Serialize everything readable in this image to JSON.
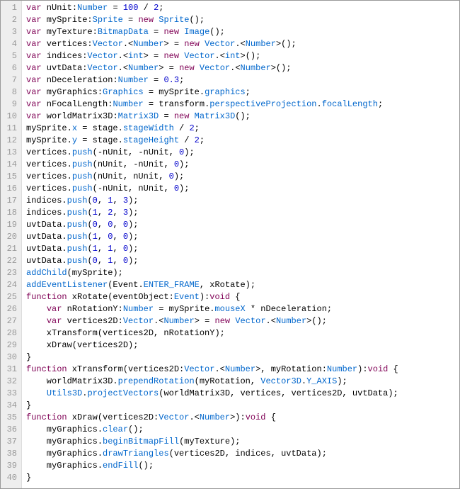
{
  "lineCount": 40,
  "lines": [
    [
      [
        "kw",
        "var"
      ],
      [
        "ident",
        " nUnit"
      ],
      [
        "op",
        ":"
      ],
      [
        "type",
        "Number"
      ],
      [
        "ident",
        " = "
      ],
      [
        "num",
        "100"
      ],
      [
        "ident",
        " / "
      ],
      [
        "num",
        "2"
      ],
      [
        "ident",
        ";"
      ]
    ],
    [
      [
        "kw",
        "var"
      ],
      [
        "ident",
        " mySprite"
      ],
      [
        "op",
        ":"
      ],
      [
        "type",
        "Sprite"
      ],
      [
        "ident",
        " = "
      ],
      [
        "kw",
        "new"
      ],
      [
        "ident",
        " "
      ],
      [
        "type",
        "Sprite"
      ],
      [
        "ident",
        "();"
      ]
    ],
    [
      [
        "kw",
        "var"
      ],
      [
        "ident",
        " myTexture"
      ],
      [
        "op",
        ":"
      ],
      [
        "type",
        "BitmapData"
      ],
      [
        "ident",
        " = "
      ],
      [
        "kw",
        "new"
      ],
      [
        "ident",
        " "
      ],
      [
        "type",
        "Image"
      ],
      [
        "ident",
        "();"
      ]
    ],
    [
      [
        "kw",
        "var"
      ],
      [
        "ident",
        " vertices"
      ],
      [
        "op",
        ":"
      ],
      [
        "type",
        "Vector"
      ],
      [
        "dot",
        "."
      ],
      [
        "ident",
        "<"
      ],
      [
        "type",
        "Number"
      ],
      [
        "ident",
        "> = "
      ],
      [
        "kw",
        "new"
      ],
      [
        "ident",
        " "
      ],
      [
        "type",
        "Vector"
      ],
      [
        "dot",
        "."
      ],
      [
        "ident",
        "<"
      ],
      [
        "type",
        "Number"
      ],
      [
        "ident",
        ">();"
      ]
    ],
    [
      [
        "kw",
        "var"
      ],
      [
        "ident",
        " indices"
      ],
      [
        "op",
        ":"
      ],
      [
        "type",
        "Vector"
      ],
      [
        "dot",
        "."
      ],
      [
        "ident",
        "<"
      ],
      [
        "type",
        "int"
      ],
      [
        "ident",
        "> = "
      ],
      [
        "kw",
        "new"
      ],
      [
        "ident",
        " "
      ],
      [
        "type",
        "Vector"
      ],
      [
        "dot",
        "."
      ],
      [
        "ident",
        "<"
      ],
      [
        "type",
        "int"
      ],
      [
        "ident",
        ">();"
      ]
    ],
    [
      [
        "kw",
        "var"
      ],
      [
        "ident",
        " uvtData"
      ],
      [
        "op",
        ":"
      ],
      [
        "type",
        "Vector"
      ],
      [
        "dot",
        "."
      ],
      [
        "ident",
        "<"
      ],
      [
        "type",
        "Number"
      ],
      [
        "ident",
        "> = "
      ],
      [
        "kw",
        "new"
      ],
      [
        "ident",
        " "
      ],
      [
        "type",
        "Vector"
      ],
      [
        "dot",
        "."
      ],
      [
        "ident",
        "<"
      ],
      [
        "type",
        "Number"
      ],
      [
        "ident",
        ">();"
      ]
    ],
    [
      [
        "kw",
        "var"
      ],
      [
        "ident",
        " nDeceleration"
      ],
      [
        "op",
        ":"
      ],
      [
        "type",
        "Number"
      ],
      [
        "ident",
        " = "
      ],
      [
        "num",
        "0.3"
      ],
      [
        "ident",
        ";"
      ]
    ],
    [
      [
        "kw",
        "var"
      ],
      [
        "ident",
        " myGraphics"
      ],
      [
        "op",
        ":"
      ],
      [
        "type",
        "Graphics"
      ],
      [
        "ident",
        " = mySprite"
      ],
      [
        "dot",
        "."
      ],
      [
        "prop",
        "graphics"
      ],
      [
        "ident",
        ";"
      ]
    ],
    [
      [
        "kw",
        "var"
      ],
      [
        "ident",
        " nFocalLength"
      ],
      [
        "op",
        ":"
      ],
      [
        "type",
        "Number"
      ],
      [
        "ident",
        " = transform"
      ],
      [
        "dot",
        "."
      ],
      [
        "prop",
        "perspectiveProjection"
      ],
      [
        "dot",
        "."
      ],
      [
        "prop",
        "focalLength"
      ],
      [
        "ident",
        ";"
      ]
    ],
    [
      [
        "kw",
        "var"
      ],
      [
        "ident",
        " worldMatrix3D"
      ],
      [
        "op",
        ":"
      ],
      [
        "type",
        "Matrix3D"
      ],
      [
        "ident",
        " = "
      ],
      [
        "kw",
        "new"
      ],
      [
        "ident",
        " "
      ],
      [
        "type",
        "Matrix3D"
      ],
      [
        "ident",
        "();"
      ]
    ],
    [
      [
        "ident",
        "mySprite"
      ],
      [
        "dot",
        "."
      ],
      [
        "prop",
        "x"
      ],
      [
        "ident",
        " = stage"
      ],
      [
        "dot",
        "."
      ],
      [
        "prop",
        "stageWidth"
      ],
      [
        "ident",
        " / "
      ],
      [
        "num",
        "2"
      ],
      [
        "ident",
        ";"
      ]
    ],
    [
      [
        "ident",
        "mySprite"
      ],
      [
        "dot",
        "."
      ],
      [
        "prop",
        "y"
      ],
      [
        "ident",
        " = stage"
      ],
      [
        "dot",
        "."
      ],
      [
        "prop",
        "stageHeight"
      ],
      [
        "ident",
        " / "
      ],
      [
        "num",
        "2"
      ],
      [
        "ident",
        ";"
      ]
    ],
    [
      [
        "ident",
        "vertices"
      ],
      [
        "dot",
        "."
      ],
      [
        "prop",
        "push"
      ],
      [
        "ident",
        "(-nUnit, -nUnit, "
      ],
      [
        "num",
        "0"
      ],
      [
        "ident",
        ");"
      ]
    ],
    [
      [
        "ident",
        "vertices"
      ],
      [
        "dot",
        "."
      ],
      [
        "prop",
        "push"
      ],
      [
        "ident",
        "(nUnit, -nUnit, "
      ],
      [
        "num",
        "0"
      ],
      [
        "ident",
        ");"
      ]
    ],
    [
      [
        "ident",
        "vertices"
      ],
      [
        "dot",
        "."
      ],
      [
        "prop",
        "push"
      ],
      [
        "ident",
        "(nUnit, nUnit, "
      ],
      [
        "num",
        "0"
      ],
      [
        "ident",
        ");"
      ]
    ],
    [
      [
        "ident",
        "vertices"
      ],
      [
        "dot",
        "."
      ],
      [
        "prop",
        "push"
      ],
      [
        "ident",
        "(-nUnit, nUnit, "
      ],
      [
        "num",
        "0"
      ],
      [
        "ident",
        ");"
      ]
    ],
    [
      [
        "ident",
        "indices"
      ],
      [
        "dot",
        "."
      ],
      [
        "prop",
        "push"
      ],
      [
        "ident",
        "("
      ],
      [
        "num",
        "0"
      ],
      [
        "ident",
        ", "
      ],
      [
        "num",
        "1"
      ],
      [
        "ident",
        ", "
      ],
      [
        "num",
        "3"
      ],
      [
        "ident",
        ");"
      ]
    ],
    [
      [
        "ident",
        "indices"
      ],
      [
        "dot",
        "."
      ],
      [
        "prop",
        "push"
      ],
      [
        "ident",
        "("
      ],
      [
        "num",
        "1"
      ],
      [
        "ident",
        ", "
      ],
      [
        "num",
        "2"
      ],
      [
        "ident",
        ", "
      ],
      [
        "num",
        "3"
      ],
      [
        "ident",
        ");"
      ]
    ],
    [
      [
        "ident",
        "uvtData"
      ],
      [
        "dot",
        "."
      ],
      [
        "prop",
        "push"
      ],
      [
        "ident",
        "("
      ],
      [
        "num",
        "0"
      ],
      [
        "ident",
        ", "
      ],
      [
        "num",
        "0"
      ],
      [
        "ident",
        ", "
      ],
      [
        "num",
        "0"
      ],
      [
        "ident",
        ");"
      ]
    ],
    [
      [
        "ident",
        "uvtData"
      ],
      [
        "dot",
        "."
      ],
      [
        "prop",
        "push"
      ],
      [
        "ident",
        "("
      ],
      [
        "num",
        "1"
      ],
      [
        "ident",
        ", "
      ],
      [
        "num",
        "0"
      ],
      [
        "ident",
        ", "
      ],
      [
        "num",
        "0"
      ],
      [
        "ident",
        ");"
      ]
    ],
    [
      [
        "ident",
        "uvtData"
      ],
      [
        "dot",
        "."
      ],
      [
        "prop",
        "push"
      ],
      [
        "ident",
        "("
      ],
      [
        "num",
        "1"
      ],
      [
        "ident",
        ", "
      ],
      [
        "num",
        "1"
      ],
      [
        "ident",
        ", "
      ],
      [
        "num",
        "0"
      ],
      [
        "ident",
        ");"
      ]
    ],
    [
      [
        "ident",
        "uvtData"
      ],
      [
        "dot",
        "."
      ],
      [
        "prop",
        "push"
      ],
      [
        "ident",
        "("
      ],
      [
        "num",
        "0"
      ],
      [
        "ident",
        ", "
      ],
      [
        "num",
        "1"
      ],
      [
        "ident",
        ", "
      ],
      [
        "num",
        "0"
      ],
      [
        "ident",
        ");"
      ]
    ],
    [
      [
        "prop",
        "addChild"
      ],
      [
        "ident",
        "(mySprite);"
      ]
    ],
    [
      [
        "prop",
        "addEventListener"
      ],
      [
        "ident",
        "(Event"
      ],
      [
        "dot",
        "."
      ],
      [
        "prop",
        "ENTER_FRAME"
      ],
      [
        "ident",
        ", xRotate);"
      ]
    ],
    [
      [
        "kw",
        "function"
      ],
      [
        "ident",
        " xRotate(eventObject"
      ],
      [
        "op",
        ":"
      ],
      [
        "type",
        "Event"
      ],
      [
        "ident",
        "):"
      ],
      [
        "kw",
        "void"
      ],
      [
        "ident",
        " {"
      ]
    ],
    [
      [
        "ident",
        "    "
      ],
      [
        "kw",
        "var"
      ],
      [
        "ident",
        " nRotationY"
      ],
      [
        "op",
        ":"
      ],
      [
        "type",
        "Number"
      ],
      [
        "ident",
        " = mySprite"
      ],
      [
        "dot",
        "."
      ],
      [
        "prop",
        "mouseX"
      ],
      [
        "ident",
        " * nDeceleration;"
      ]
    ],
    [
      [
        "ident",
        "    "
      ],
      [
        "kw",
        "var"
      ],
      [
        "ident",
        " vertices2D"
      ],
      [
        "op",
        ":"
      ],
      [
        "type",
        "Vector"
      ],
      [
        "dot",
        "."
      ],
      [
        "ident",
        "<"
      ],
      [
        "type",
        "Number"
      ],
      [
        "ident",
        "> = "
      ],
      [
        "kw",
        "new"
      ],
      [
        "ident",
        " "
      ],
      [
        "type",
        "Vector"
      ],
      [
        "dot",
        "."
      ],
      [
        "ident",
        "<"
      ],
      [
        "type",
        "Number"
      ],
      [
        "ident",
        ">();"
      ]
    ],
    [
      [
        "ident",
        "    xTransform(vertices2D, nRotationY);"
      ]
    ],
    [
      [
        "ident",
        "    xDraw(vertices2D);"
      ]
    ],
    [
      [
        "ident",
        "}"
      ]
    ],
    [
      [
        "kw",
        "function"
      ],
      [
        "ident",
        " xTransform(vertices2D"
      ],
      [
        "op",
        ":"
      ],
      [
        "type",
        "Vector"
      ],
      [
        "dot",
        "."
      ],
      [
        "ident",
        "<"
      ],
      [
        "type",
        "Number"
      ],
      [
        "ident",
        ">, myRotation"
      ],
      [
        "op",
        ":"
      ],
      [
        "type",
        "Number"
      ],
      [
        "ident",
        "):"
      ],
      [
        "kw",
        "void"
      ],
      [
        "ident",
        " {"
      ]
    ],
    [
      [
        "ident",
        "    worldMatrix3D"
      ],
      [
        "dot",
        "."
      ],
      [
        "prop",
        "prependRotation"
      ],
      [
        "ident",
        "(myRotation, "
      ],
      [
        "type",
        "Vector3D"
      ],
      [
        "dot",
        "."
      ],
      [
        "prop",
        "Y_AXIS"
      ],
      [
        "ident",
        ");"
      ]
    ],
    [
      [
        "ident",
        "    "
      ],
      [
        "type",
        "Utils3D"
      ],
      [
        "dot",
        "."
      ],
      [
        "prop",
        "projectVectors"
      ],
      [
        "ident",
        "(worldMatrix3D, vertices, vertices2D, uvtData);"
      ]
    ],
    [
      [
        "ident",
        "}"
      ]
    ],
    [
      [
        "kw",
        "function"
      ],
      [
        "ident",
        " xDraw(vertices2D"
      ],
      [
        "op",
        ":"
      ],
      [
        "type",
        "Vector"
      ],
      [
        "dot",
        "."
      ],
      [
        "ident",
        "<"
      ],
      [
        "type",
        "Number"
      ],
      [
        "ident",
        ">):"
      ],
      [
        "kw",
        "void"
      ],
      [
        "ident",
        " {"
      ]
    ],
    [
      [
        "ident",
        "    myGraphics"
      ],
      [
        "dot",
        "."
      ],
      [
        "prop",
        "clear"
      ],
      [
        "ident",
        "();"
      ]
    ],
    [
      [
        "ident",
        "    myGraphics"
      ],
      [
        "dot",
        "."
      ],
      [
        "prop",
        "beginBitmapFill"
      ],
      [
        "ident",
        "(myTexture);"
      ]
    ],
    [
      [
        "ident",
        "    myGraphics"
      ],
      [
        "dot",
        "."
      ],
      [
        "prop",
        "drawTriangles"
      ],
      [
        "ident",
        "(vertices2D, indices, uvtData);"
      ]
    ],
    [
      [
        "ident",
        "    myGraphics"
      ],
      [
        "dot",
        "."
      ],
      [
        "prop",
        "endFill"
      ],
      [
        "ident",
        "();"
      ]
    ],
    [
      [
        "ident",
        "}"
      ]
    ]
  ]
}
